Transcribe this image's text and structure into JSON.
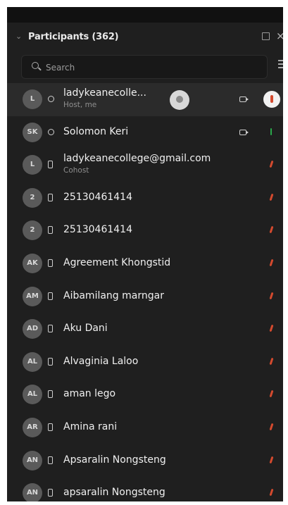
{
  "panel": {
    "title": "Participants (362)",
    "search_placeholder": "Search"
  },
  "participants": [
    {
      "initials": "L",
      "name": "ladykeanecolle...",
      "role": "Host, me",
      "device": "cam",
      "video": true,
      "mic": "host-badge",
      "highlighted": true
    },
    {
      "initials": "SK",
      "name": "Solomon Keri",
      "role": "",
      "device": "cam",
      "video": true,
      "mic": "green"
    },
    {
      "initials": "L",
      "name": "ladykeanecollege@gmail.com",
      "role": "Cohost",
      "device": "phone",
      "video": false,
      "mic": "muted"
    },
    {
      "initials": "2",
      "name": "25130461414",
      "role": "",
      "device": "phone",
      "video": false,
      "mic": "muted"
    },
    {
      "initials": "2",
      "name": "25130461414",
      "role": "",
      "device": "phone",
      "video": false,
      "mic": "muted"
    },
    {
      "initials": "AK",
      "name": "Agreement Khongstid",
      "role": "",
      "device": "phone",
      "video": false,
      "mic": "muted"
    },
    {
      "initials": "AM",
      "name": "Aibamilang marngar",
      "role": "",
      "device": "phone",
      "video": false,
      "mic": "muted"
    },
    {
      "initials": "AD",
      "name": "Aku Dani",
      "role": "",
      "device": "phone",
      "video": false,
      "mic": "muted"
    },
    {
      "initials": "AL",
      "name": "Alvaginia Laloo",
      "role": "",
      "device": "phone",
      "video": false,
      "mic": "muted"
    },
    {
      "initials": "AL",
      "name": "aman lego",
      "role": "",
      "device": "phone",
      "video": false,
      "mic": "muted"
    },
    {
      "initials": "AR",
      "name": "Amina rani",
      "role": "",
      "device": "phone",
      "video": false,
      "mic": "muted"
    },
    {
      "initials": "AN",
      "name": "Apsaralin Nongsteng",
      "role": "",
      "device": "phone",
      "video": false,
      "mic": "muted"
    },
    {
      "initials": "AN",
      "name": "apsaralin Nongsteng",
      "role": "",
      "device": "phone",
      "video": false,
      "mic": "muted"
    }
  ]
}
